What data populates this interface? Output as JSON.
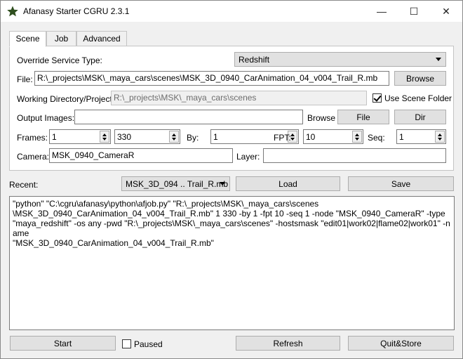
{
  "window": {
    "title": "Afanasy Starter   CGRU 2.3.1",
    "minimize": "—",
    "maximize": "☐",
    "close": "✕"
  },
  "tabs": [
    {
      "label": "Scene",
      "active": true
    },
    {
      "label": "Job",
      "active": false
    },
    {
      "label": "Advanced",
      "active": false
    }
  ],
  "scene": {
    "override_label": "Override Service Type:",
    "override_value": "Redshift",
    "file_label": "File:",
    "file_value": "R:\\_projects\\MSK\\_maya_cars\\scenes\\MSK_3D_0940_CarAnimation_04_v004_Trail_R.mb",
    "browse_label": "Browse",
    "wd_label": "Working Directory/Project:",
    "wd_value": "R:\\_projects\\MSK\\_maya_cars\\scenes",
    "use_scene_folder_label": "Use Scene Folder",
    "use_scene_folder_checked": true,
    "output_label": "Output Images:",
    "output_value": "",
    "output_browse_label": "Browse",
    "file_button_label": "File",
    "dir_button_label": "Dir",
    "frames_label": "Frames:",
    "frame_start": "1",
    "frame_end": "330",
    "by_label": "By:",
    "by_value": "1",
    "fpt_label": "FPT:",
    "fpt_value": "10",
    "seq_label": "Seq:",
    "seq_value": "1",
    "camera_label": "Camera:",
    "camera_value": "MSK_0940_CameraR",
    "layer_label": "Layer:",
    "layer_value": ""
  },
  "recent": {
    "label": "Recent:",
    "value": "MSK_3D_094 .. Trail_R.mb",
    "load_label": "Load",
    "save_label": "Save"
  },
  "command": "\"python\" \"C:\\cgru\\afanasy\\python\\afjob.py\" \"R:\\_projects\\MSK\\_maya_cars\\scenes\n\\MSK_3D_0940_CarAnimation_04_v004_Trail_R.mb\" 1 330 -by 1 -fpt 10 -seq 1 -node \"MSK_0940_CameraR\" -type\n\"maya_redshift\" -os any -pwd \"R:\\_projects\\MSK\\_maya_cars\\scenes\" -hostsmask \"edit01|work02|flame02|work01\" -name\n\"MSK_3D_0940_CarAnimation_04_v004_Trail_R.mb\"",
  "bottom": {
    "start_label": "Start",
    "paused_label": "Paused",
    "paused_checked": false,
    "refresh_label": "Refresh",
    "quit_label": "Quit&Store"
  },
  "colors": {
    "icon_star": "#2f4f1f",
    "window_bg": "#f0f0f0"
  }
}
